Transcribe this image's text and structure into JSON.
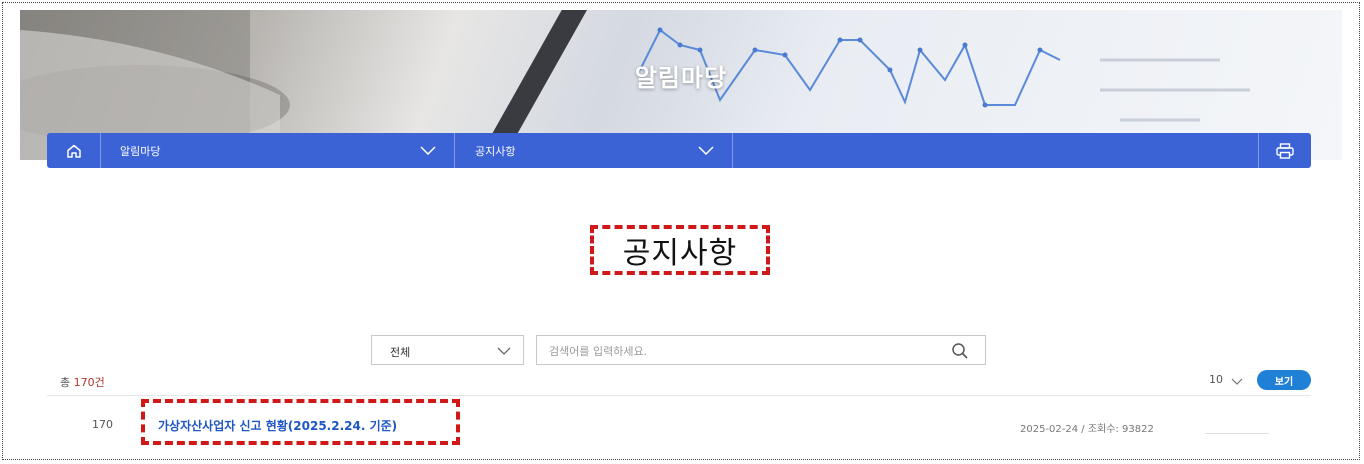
{
  "hero": {
    "title": "알림마당"
  },
  "nav": {
    "home_icon": "home-icon",
    "depth1_label": "알림마당",
    "depth2_label": "공지사항",
    "print_icon": "printer-icon",
    "accent": "#3b63d6"
  },
  "page": {
    "title": "공지사항"
  },
  "search": {
    "category_selected": "전체",
    "placeholder": "검색어를 입력하세요.",
    "search_icon": "search-icon"
  },
  "list": {
    "total_prefix": "총 ",
    "total_count": "170건",
    "per_page": "10",
    "view_button": "보기",
    "rows": [
      {
        "number": "170",
        "title": "가상자산사업자 신고 현황(2025.2.24. 기준)",
        "meta": "2025-02-24 / 조회수: 93822"
      }
    ]
  },
  "colors": {
    "highlight": "#d11818",
    "link": "#1e56c4",
    "button": "#1f80d6"
  }
}
